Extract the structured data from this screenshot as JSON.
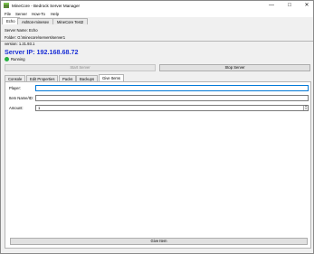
{
  "window": {
    "title": "MineCore - Bedrock Server Manager",
    "controls": {
      "minimize": "—",
      "maximize": "☐",
      "close": "✕"
    }
  },
  "menu": [
    "File",
    "Server",
    "How-To",
    "Help"
  ],
  "server_tabs": [
    "Echo",
    "Ashton-minesev",
    "MineCore Test2"
  ],
  "server_info": {
    "name": "Server Name: Echo",
    "folder": "Folder: G:\\minecore\\servers\\server1",
    "version": "version: 1.21.93.1",
    "ip": "Server IP: 192.168.68.72",
    "status": "Running",
    "status_color": "#27b341",
    "ip_color": "#1a2fd6"
  },
  "buttons": {
    "start": "Start Server",
    "stop": "Stop Server",
    "give": "Give Item"
  },
  "detail_tabs": [
    "Console",
    "Edit Properties",
    "Packs",
    "Backups",
    "Give Items"
  ],
  "give_items": {
    "player_label": "Player:",
    "player_value": "",
    "item_label": "Item Name/ID:",
    "item_value": "",
    "amount_label": "Amount:",
    "amount_value": "1"
  }
}
